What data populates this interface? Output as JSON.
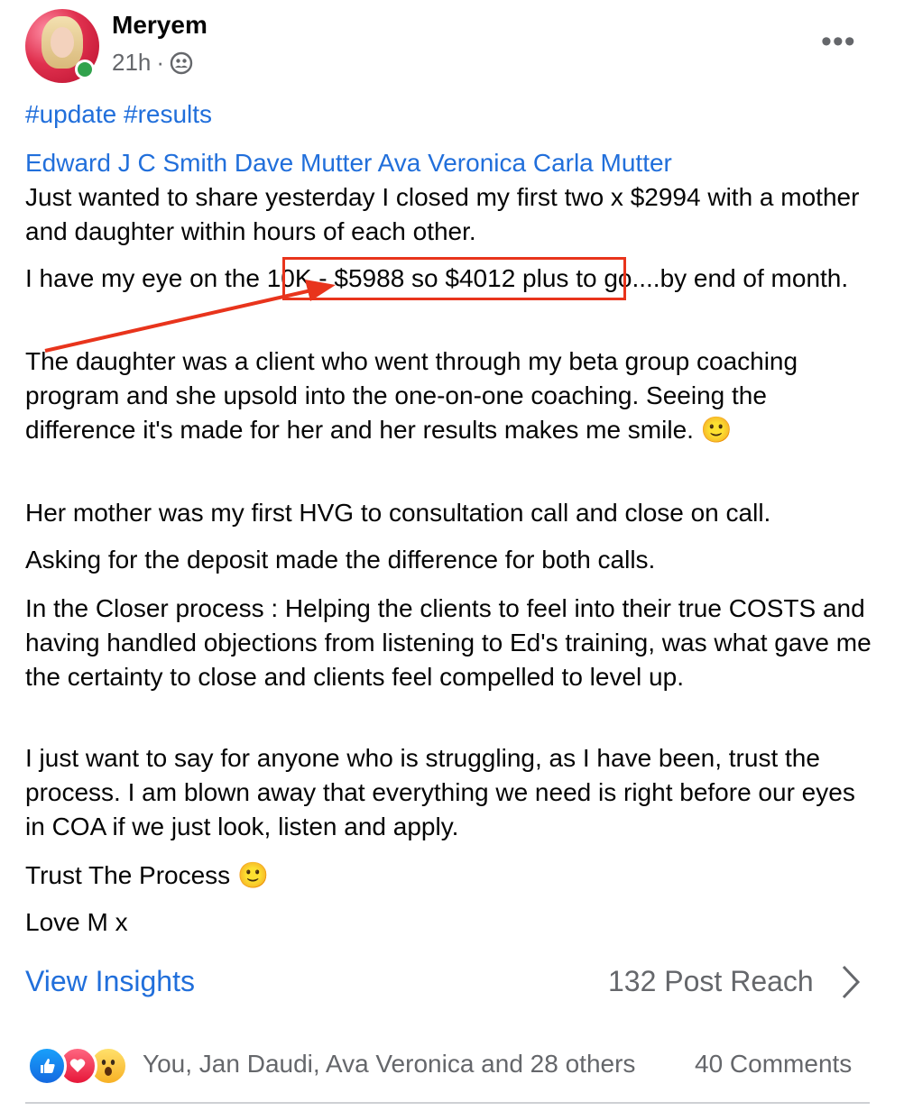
{
  "header": {
    "author": "Meryem",
    "time": "21h",
    "separator": "·",
    "audience_icon": "group-icon",
    "more_icon": "more-horizontal-icon"
  },
  "post": {
    "hashtags": "#update #results",
    "tags": "Edward J C Smith Dave Mutter Ava Veronica Carla Mutter",
    "paragraphs": [
      "Just wanted to share yesterday I closed my first two x $2994 with a mother and daughter within hours of each other.",
      "I have my eye on the 10K - $5988 so $4012 plus to go....by end of month.",
      "The daughter was a client who went through my beta group coaching program and she upsold into the one-on-one coaching. Seeing the difference it's made for her and her results makes me smile. 🙂",
      "Her mother was my first HVG to consultation call and close on call.",
      "Asking for the deposit made the difference for both calls.",
      "In the Closer process : Helping the clients to feel into their true COSTS and having handled objections from listening to Ed's training, was what gave me the certainty to close and clients feel compelled to level up.",
      "I just want to say for anyone who is struggling, as I have been, trust the process. I am blown away that everything we need is right before our eyes in COA if we just look, listen and apply.",
      "Trust The Process 🙂",
      "Love M x"
    ],
    "highlight_color": "#e8341c"
  },
  "footer": {
    "view_insights": "View Insights",
    "post_reach": "132 Post Reach",
    "reactions": "You, Jan Daudi, Ava Veronica and 28 others",
    "comments": "40 Comments",
    "reaction_icons": [
      "like-icon",
      "love-icon",
      "wow-icon"
    ]
  },
  "colors": {
    "link": "#216fdb",
    "secondary_text": "#65676b",
    "online": "#31a24c"
  }
}
